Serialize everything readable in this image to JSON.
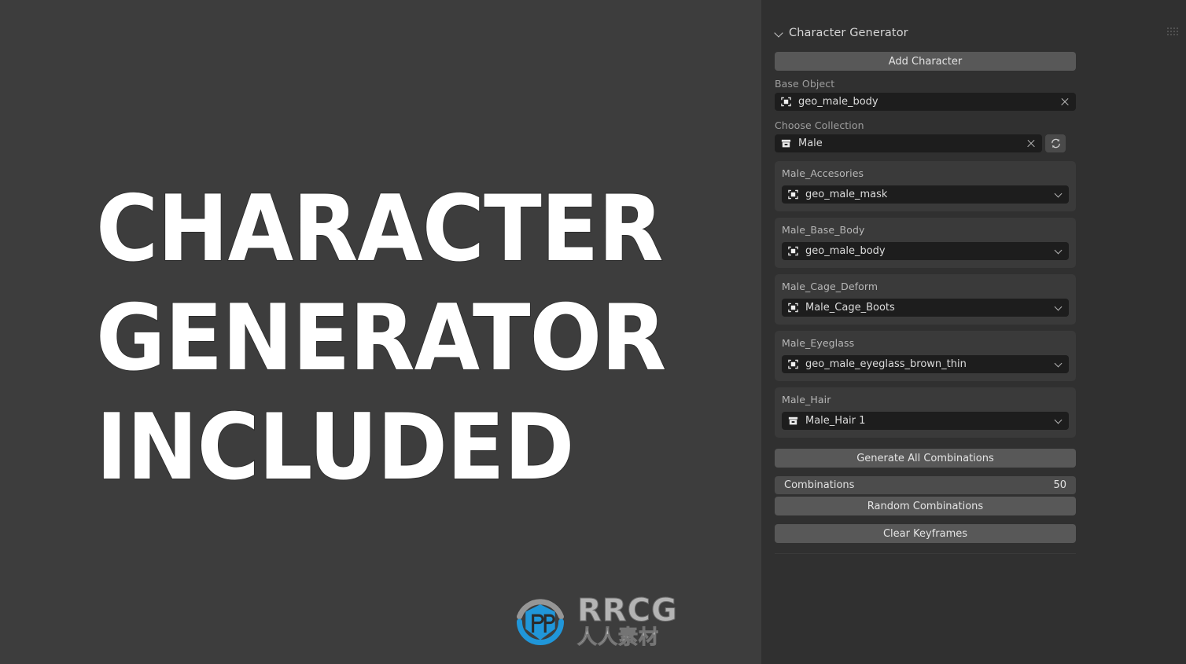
{
  "promo": {
    "lines": [
      "CHARACTER",
      "GENERATOR",
      "INCLUDED"
    ]
  },
  "watermark": {
    "brand": "RRCG",
    "subtitle": "人人素材",
    "logo_icon": "rrcg-shield-icon"
  },
  "panel": {
    "title": "Character Generator",
    "collapse_icon": "chevron-down-icon",
    "grip_icon": "drag-grip-icon",
    "add_character_label": "Add Character",
    "base_object": {
      "label": "Base Object",
      "value": "geo_male_body",
      "icon": "mesh-object-icon",
      "clear_icon": "close-icon"
    },
    "choose_collection": {
      "label": "Choose Collection",
      "value": "Male",
      "icon": "collection-icon",
      "clear_icon": "close-icon",
      "refresh_icon": "refresh-icon"
    },
    "groups": [
      {
        "title": "Male_Accesories",
        "value": "geo_male_mask",
        "icon": "mesh-object-icon",
        "caret_icon": "chevron-down-icon"
      },
      {
        "title": "Male_Base_Body",
        "value": "geo_male_body",
        "icon": "mesh-object-icon",
        "caret_icon": "chevron-down-icon"
      },
      {
        "title": "Male_Cage_Deform",
        "value": "Male_Cage_Boots",
        "icon": "mesh-object-icon",
        "caret_icon": "chevron-down-icon"
      },
      {
        "title": "Male_Eyeglass",
        "value": "geo_male_eyeglass_brown_thin",
        "icon": "mesh-object-icon",
        "caret_icon": "chevron-down-icon"
      },
      {
        "title": "Male_Hair",
        "value": "Male_Hair 1",
        "icon": "collection-icon",
        "caret_icon": "chevron-down-icon"
      }
    ],
    "generate_all_label": "Generate All Combinations",
    "combinations": {
      "label": "Combinations",
      "value": "50"
    },
    "random_combinations_label": "Random Combinations",
    "clear_keyframes_label": "Clear Keyframes"
  },
  "colors": {
    "background": "#3d3d3d",
    "panel_bg": "#303030",
    "group_bg": "#3a3a3a",
    "field_bg": "#1d1d1d",
    "button_bg": "#585858",
    "accent_blue": "#1f9ae0"
  }
}
